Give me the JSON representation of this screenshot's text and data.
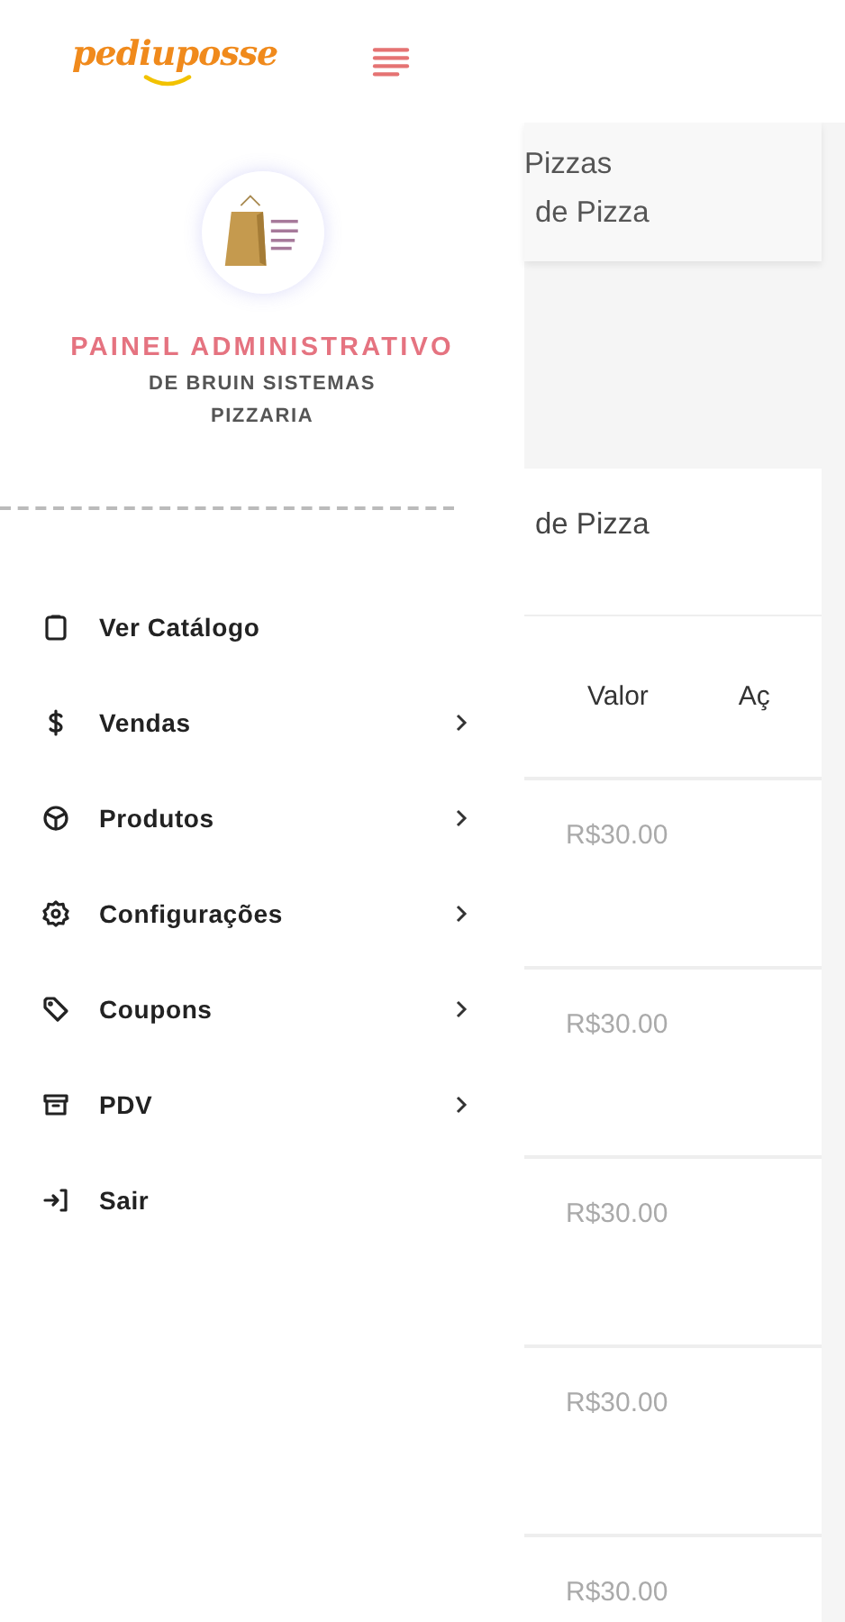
{
  "header": {
    "logo": "pediuposse"
  },
  "drawer": {
    "title": "PAINEL ADMINISTRATIVO",
    "subtitle_lines": [
      "DE BRUIN SISTEMAS",
      "PIZZARIA"
    ],
    "menu": [
      {
        "label": "Ver Catálogo",
        "has_submenu": false
      },
      {
        "label": "Vendas",
        "has_submenu": true
      },
      {
        "label": "Produtos",
        "has_submenu": true
      },
      {
        "label": "Configurações",
        "has_submenu": true
      },
      {
        "label": "Coupons",
        "has_submenu": true
      },
      {
        "label": "PDV",
        "has_submenu": true
      },
      {
        "label": "Sair",
        "has_submenu": false
      }
    ]
  },
  "page_card": {
    "lines": [
      "Pizzas",
      "de Pizza"
    ]
  },
  "table_card": {
    "title": "de Pizza",
    "columns": [
      "Valor",
      "Aç"
    ],
    "rows": [
      {
        "valor": "R$30.00"
      },
      {
        "valor": "R$30.00"
      },
      {
        "valor": "R$30.00"
      },
      {
        "valor": "R$30.00"
      },
      {
        "valor": "R$30.00"
      }
    ]
  }
}
